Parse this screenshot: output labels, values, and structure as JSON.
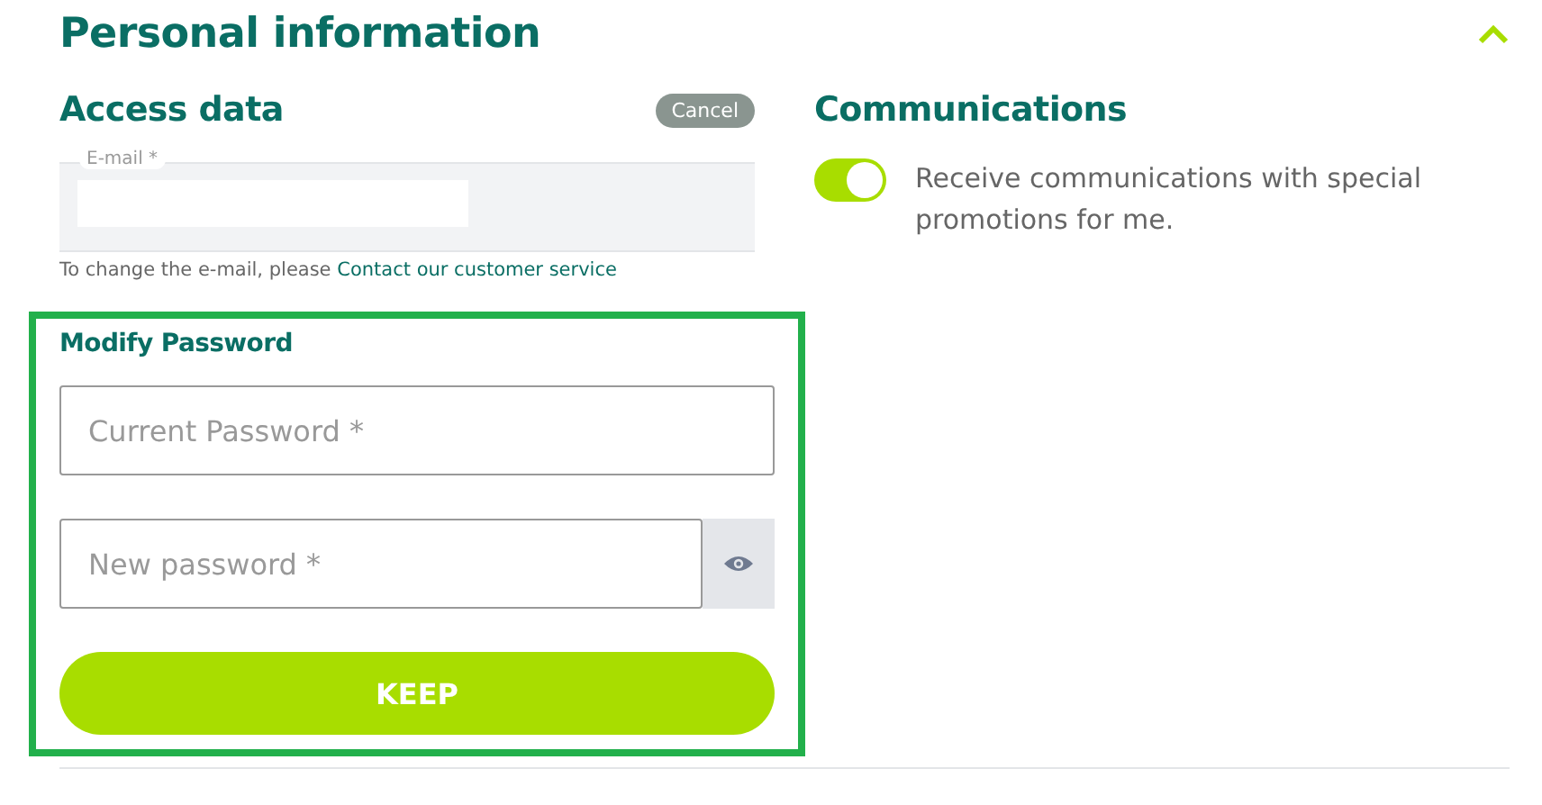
{
  "title": "Personal information",
  "access": {
    "title": "Access data",
    "cancel": "Cancel",
    "email": {
      "label": "E-mail *"
    },
    "hint": "To change the e-mail, please",
    "hint_link": "Contact our customer service"
  },
  "password": {
    "title": "Modify Password",
    "fields": [
      {
        "placeholder": "Current Password *",
        "reveal": false
      },
      {
        "placeholder": "New password *",
        "reveal": true
      }
    ],
    "submit": "KEEP"
  },
  "communications": {
    "title": "Communications",
    "toggle": {
      "on": true,
      "label": "Receive communications with special promotions for me."
    }
  }
}
